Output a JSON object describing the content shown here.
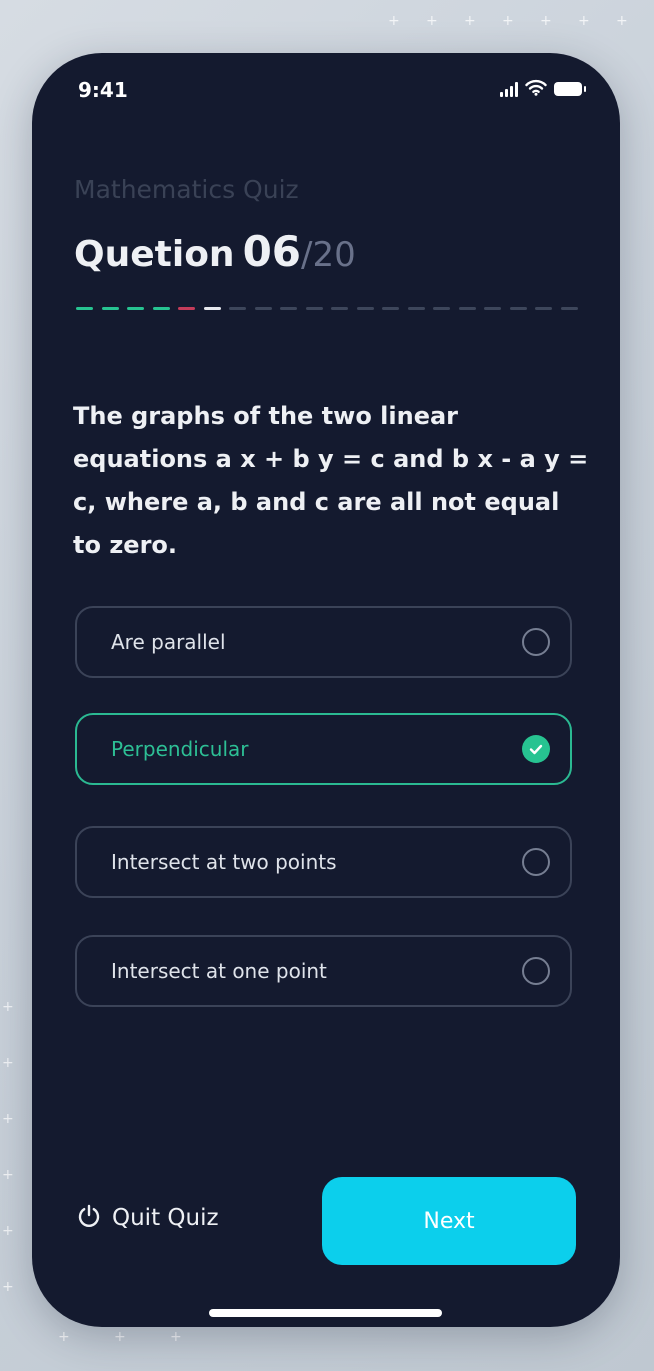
{
  "status_bar": {
    "time": "9:41",
    "icons": [
      "signal-icon",
      "wifi-icon",
      "battery-icon"
    ]
  },
  "quiz": {
    "subject": "Mathematics Quiz",
    "question_label": "Quetion",
    "current": "06",
    "separator": "/",
    "total": "20",
    "progress": {
      "segments_total": 20,
      "states": [
        "correct",
        "correct",
        "correct",
        "correct",
        "wrong",
        "current",
        "upcoming",
        "upcoming",
        "upcoming",
        "upcoming",
        "upcoming",
        "upcoming",
        "upcoming",
        "upcoming",
        "upcoming",
        "upcoming",
        "upcoming",
        "upcoming",
        "upcoming",
        "upcoming"
      ]
    },
    "question_text": "The graphs of the two linear equations a x + b y = c and b x - a y = c, where a, b and c are all not equal to zero."
  },
  "options": [
    {
      "label": "Are parallel",
      "selected": false
    },
    {
      "label": "Perpendicular",
      "selected": true
    },
    {
      "label": "Intersect at two points",
      "selected": false
    },
    {
      "label": "Intersect at one point",
      "selected": false
    }
  ],
  "footer": {
    "quit_label": "Quit Quiz",
    "quit_icon": "power-icon",
    "next_label": "Next"
  },
  "colors": {
    "background": "#141a2f",
    "correct": "#27c391",
    "wrong": "#c43c5a",
    "current": "#e6e8ee",
    "upcoming": "#3d465b",
    "accent": "#0ccfec"
  }
}
